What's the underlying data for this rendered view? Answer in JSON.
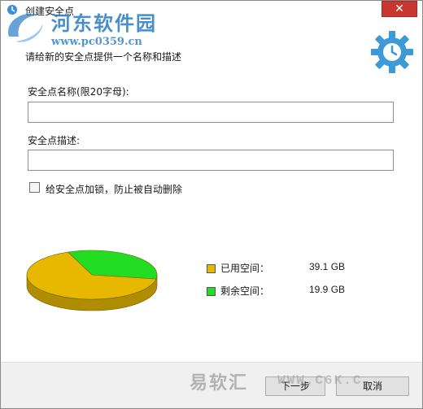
{
  "window": {
    "title": "创建安全点",
    "close_symbol": "✕"
  },
  "watermark": {
    "logo_text": "河东软件园",
    "url": "www.pc0359.cn",
    "bottom_logo": "易软汇",
    "bottom_url": "WWW.C6K.C"
  },
  "header": {
    "subtitle": "请给新的安全点提供一个名称和描述",
    "icon": "gear-clock-icon"
  },
  "form": {
    "name_label": "安全点名称(限20字母):",
    "name_value": "",
    "desc_label": "安全点描述:",
    "desc_value": "",
    "lock_label": "给安全点加锁，防止被自动删除",
    "lock_checked": false
  },
  "disk": {
    "used_label": "已用空间：",
    "used_value": "39.1 GB",
    "free_label": "剩余空间：",
    "free_value": "19.9 GB",
    "used_color": "#e8b800",
    "free_color": "#22dd22"
  },
  "chart_data": {
    "type": "pie",
    "categories": [
      "已用空间",
      "剩余空间"
    ],
    "values": [
      39.1,
      19.9
    ],
    "unit": "GB"
  },
  "footer": {
    "next_label": "下一步",
    "cancel_label": "取消"
  }
}
